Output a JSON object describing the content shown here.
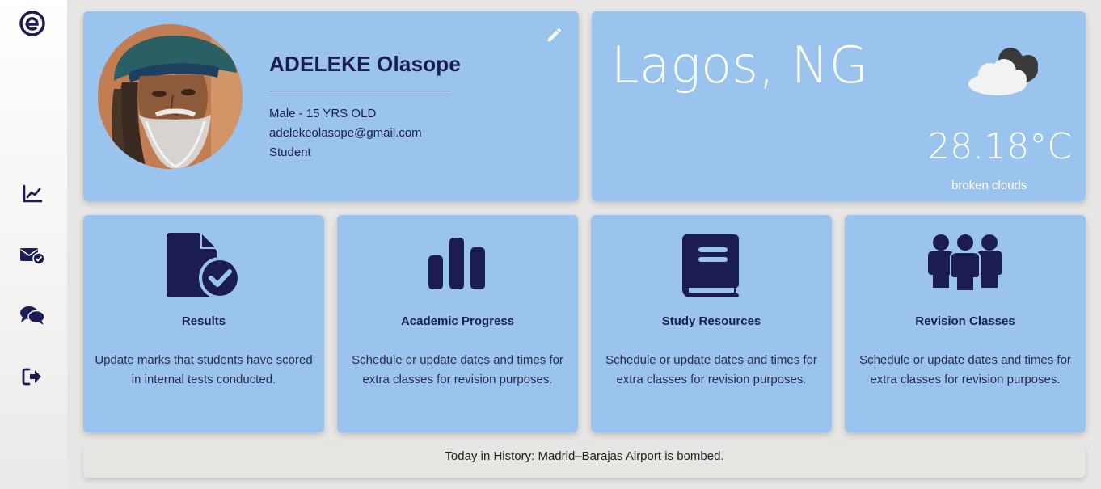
{
  "sidebar": {
    "logo_icon": "e-logo-icon",
    "items": [
      {
        "icon": "chart-line-icon",
        "label": "Analytics"
      },
      {
        "icon": "mail-check-icon",
        "label": "Messages"
      },
      {
        "icon": "chat-bubbles-icon",
        "label": "Chat"
      },
      {
        "icon": "logout-icon",
        "label": "Logout"
      }
    ]
  },
  "profile": {
    "name": "ADELEKE Olasope",
    "gender_age": "Male - 15 YRS OLD",
    "email": "adelekeolasope@gmail.com",
    "role": "Student",
    "edit_icon": "pencil-icon"
  },
  "weather": {
    "city": "Lagos, NG",
    "temperature": "28.18°C",
    "description": "broken clouds",
    "icon": "cloud-icon"
  },
  "features": [
    {
      "title": "Results",
      "description": "Update marks that students have scored in internal tests conducted.",
      "icon": "file-check-icon"
    },
    {
      "title": "Academic Progress",
      "description": "Schedule or update dates and times for extra classes for revision purposes.",
      "icon": "bar-chart-icon"
    },
    {
      "title": "Study Resources",
      "description": "Schedule or update dates and times for extra classes for revision purposes.",
      "icon": "book-icon"
    },
    {
      "title": "Revision Classes",
      "description": "Schedule or update dates and times for extra classes for revision purposes.",
      "icon": "users-group-icon"
    }
  ],
  "history": {
    "text": "Today in History: Madrid–Barajas Airport is bombed."
  },
  "colors": {
    "card": "#9ac4ee",
    "navy": "#1c1c54",
    "background": "#e8e6e4"
  }
}
